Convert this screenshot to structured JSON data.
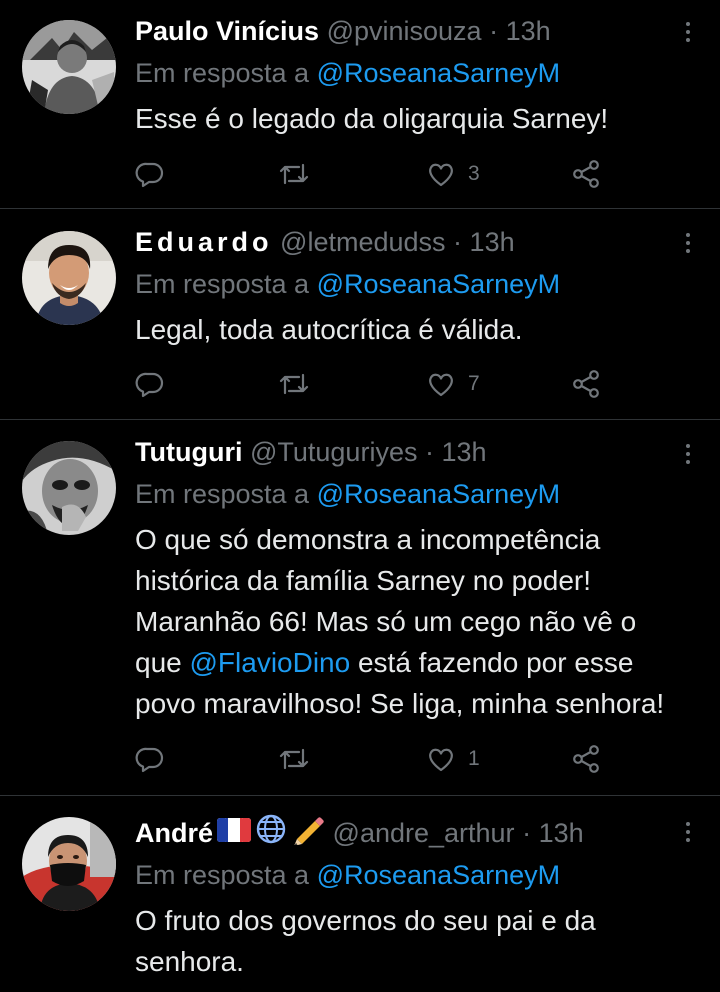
{
  "tweets": [
    {
      "name": "Paulo Vinícius",
      "handle": "@pvinisouza",
      "separator": "·",
      "time": "13h",
      "reply_prefix": "Em resposta a",
      "reply_to": "@RoseanaSarneyM",
      "text_lines": [
        "Esse é o legado da oligarquia Sarney!"
      ],
      "likes": "3",
      "avatar": "vintage-photo"
    },
    {
      "name": "Eduardo",
      "handle": "@letmedudss",
      "separator": "·",
      "time": "13h",
      "reply_prefix": "Em resposta a",
      "reply_to": "@RoseanaSarneyM",
      "text_lines": [
        "Legal, toda autocrítica é válida."
      ],
      "likes": "7",
      "avatar": "smiling-man"
    },
    {
      "name": "Tutuguri",
      "handle": "@Tutuguriyes",
      "separator": "·",
      "time": "13h",
      "reply_prefix": "Em resposta a",
      "reply_to": "@RoseanaSarneyM",
      "text_lines": [
        "O que só demonstra a incompetência",
        "histórica da família Sarney no poder!",
        "Maranhão 66! Mas só um cego não vê o",
        "que @FlavioDino está fazendo por esse",
        "povo maravilhoso! Se liga, minha senhora!"
      ],
      "mention_in_text": "@FlavioDino",
      "text_line4_after": " está fazendo por esse",
      "text_line4_before": "que ",
      "likes": "1",
      "avatar": "bw-portrait"
    },
    {
      "name": "André",
      "handle": "@andre_arthur",
      "separator": "·",
      "time": "13h",
      "name_emojis": [
        "flag-france-icon",
        "globe-icon",
        "pencil-icon"
      ],
      "reply_prefix": "Em resposta a",
      "reply_to": "@RoseanaSarneyM",
      "text_lines": [
        "O fruto dos governos do seu pai e da",
        "senhora."
      ],
      "likes": "",
      "avatar": "masked-man"
    }
  ],
  "colors": {
    "background": "#000000",
    "text": "#e7e9ea",
    "secondary": "#71767b",
    "accent": "#1d9bf0",
    "divider": "#2f3336"
  }
}
